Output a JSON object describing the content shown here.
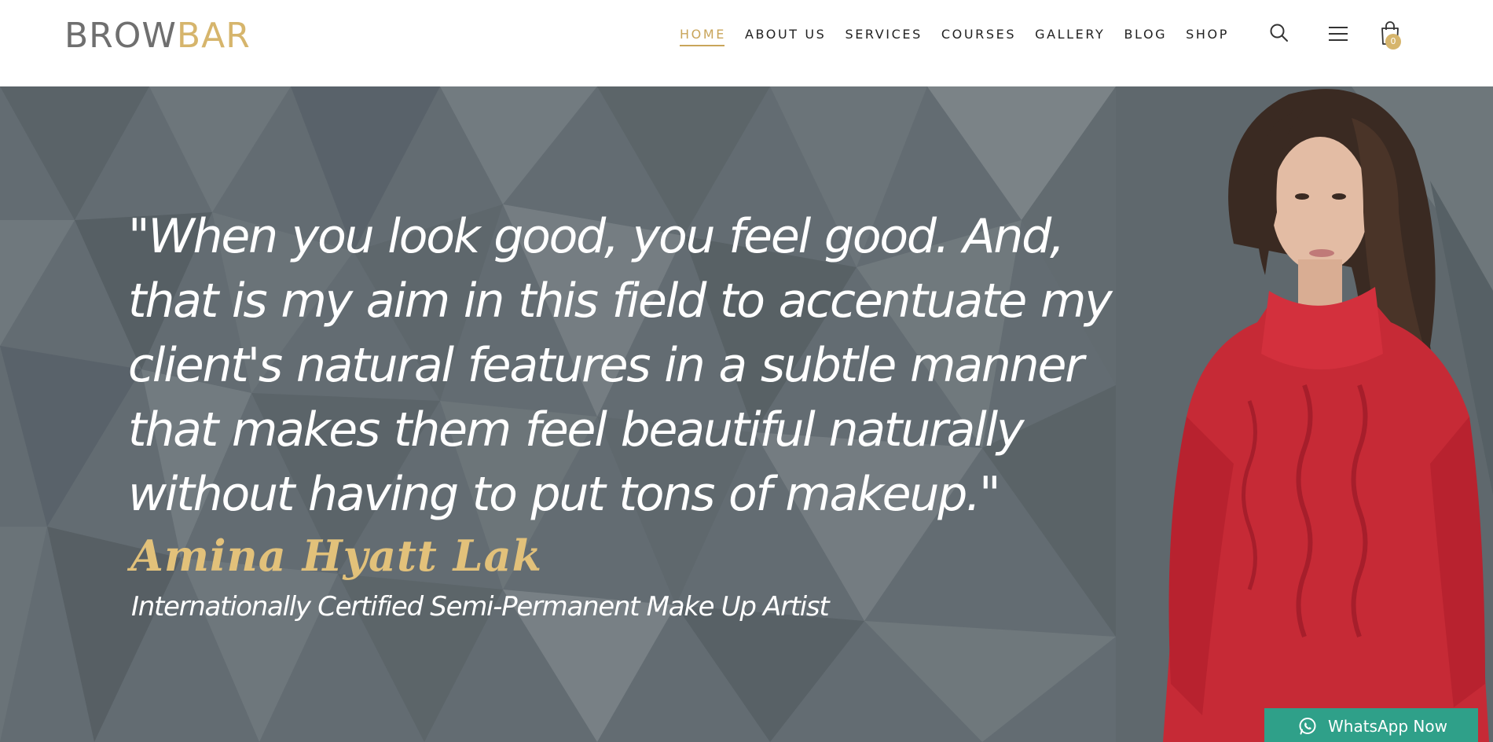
{
  "logo": {
    "part1": "BROW",
    "part2": "BAR"
  },
  "nav": {
    "items": [
      {
        "label": "HOME",
        "active": true
      },
      {
        "label": "ABOUT US"
      },
      {
        "label": "SERVICES"
      },
      {
        "label": "COURSES"
      },
      {
        "label": "GALLERY"
      },
      {
        "label": "BLOG"
      },
      {
        "label": "SHOP"
      }
    ],
    "cart_count": "0"
  },
  "hero": {
    "quote_lines": [
      "\"When you look good, you feel good. And,",
      "that is my aim in this field to accentuate my",
      " client's natural features in a subtle manner",
      " that makes them feel beautiful naturally",
      "without having to put tons of makeup.\""
    ],
    "author": "Amina Hyatt Lak",
    "subtitle": "Internationally Certified Semi-Permanent Make Up Artist"
  },
  "whatsapp": {
    "label": "WhatsApp Now"
  },
  "colors": {
    "accent_gold": "#d6b56c",
    "nav_text": "#222222",
    "hero_bg": "#606a70",
    "whatsapp_green": "#2fa089"
  },
  "icons": [
    "search-icon",
    "hamburger-menu-icon",
    "shopping-bag-icon",
    "whatsapp-icon"
  ]
}
